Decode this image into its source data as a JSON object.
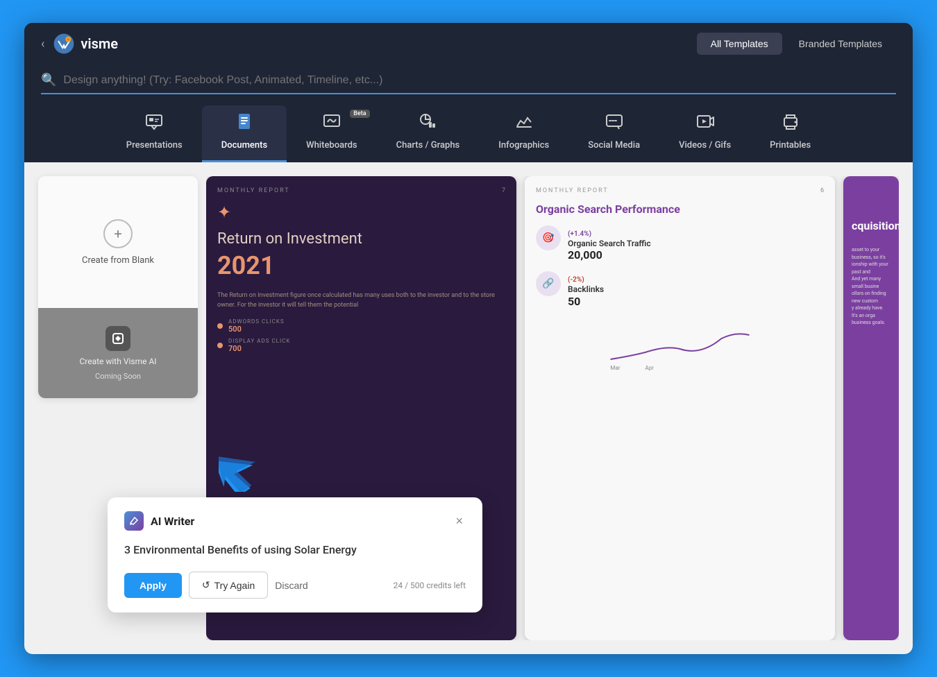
{
  "app": {
    "logo_text": "visme",
    "back_arrow": "‹"
  },
  "header": {
    "tab_all_templates": "All Templates",
    "tab_branded_templates": "Branded Templates"
  },
  "search": {
    "placeholder": "Design anything! (Try: Facebook Post, Animated, Timeline, etc...)"
  },
  "nav_tabs": [
    {
      "id": "presentations",
      "label": "Presentations",
      "icon": "🖥",
      "active": false,
      "beta": false
    },
    {
      "id": "documents",
      "label": "Documents",
      "icon": "📄",
      "active": true,
      "beta": false
    },
    {
      "id": "whiteboards",
      "label": "Whiteboards",
      "icon": "✏",
      "active": false,
      "beta": true
    },
    {
      "id": "charts-graphs",
      "label": "Charts / Graphs",
      "icon": "📊",
      "active": false,
      "beta": false
    },
    {
      "id": "infographics",
      "label": "Infographics",
      "icon": "📈",
      "active": false,
      "beta": false
    },
    {
      "id": "social-media",
      "label": "Social Media",
      "icon": "💬",
      "active": false,
      "beta": false
    },
    {
      "id": "videos-gifs",
      "label": "Videos / Gifs",
      "icon": "▶",
      "active": false,
      "beta": false
    },
    {
      "id": "printables",
      "label": "Printables",
      "icon": "🖨",
      "active": false,
      "beta": false
    }
  ],
  "create_blank": {
    "label": "Create from Blank",
    "ai_label": "Create with Visme AI",
    "coming_soon": "Coming Soon"
  },
  "template_card_1": {
    "header": "MONTHLY REPORT",
    "number": "7",
    "title": "Return on Investment",
    "year": "2021",
    "description": "The Return on Investment figure once calculated has many uses both to the investor and to the store owner. For the investor it will tell them the potential",
    "metric1_label": "ADWORDS CLICKS",
    "metric1_value": "500",
    "metric2_label": "DISPLAY ADS CLICK",
    "metric2_value": "700"
  },
  "template_card_2": {
    "header": "MONTHLY REPORT",
    "number": "6",
    "title": "Organic Search Performance",
    "metric1_change": "(+1.4%)",
    "metric1_name": "Organic Search Traffic",
    "metric1_value": "20,000",
    "metric2_change": "(-2%)",
    "metric2_name": "Backlinks",
    "metric2_value": "50"
  },
  "template_card_3": {
    "acq_title": "cquisition"
  },
  "ai_writer_popup": {
    "title": "AI Writer",
    "content": "3 Environmental Benefits of using Solar Energy",
    "apply_label": "Apply",
    "try_again_label": "Try Again",
    "discard_label": "Discard",
    "credits_used": "24",
    "credits_total": "500",
    "credits_label": "credits left"
  }
}
